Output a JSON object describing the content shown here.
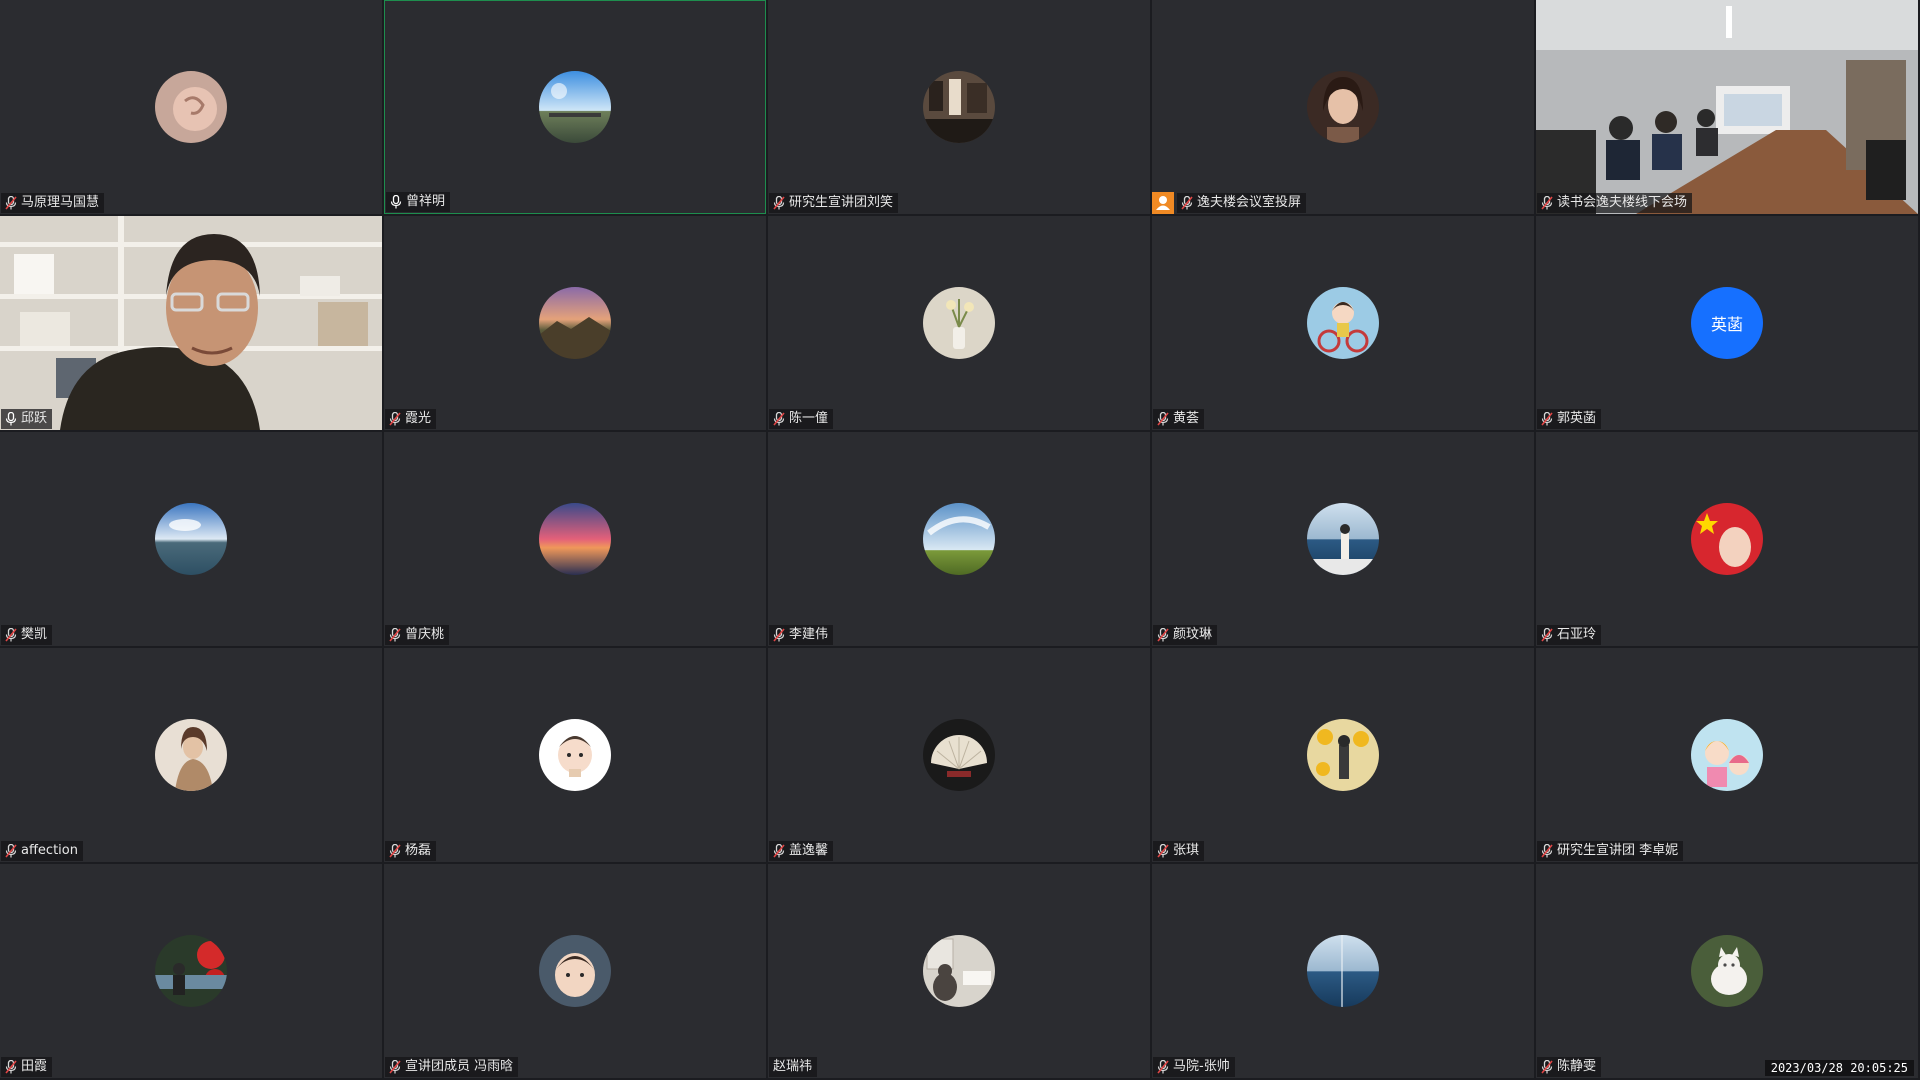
{
  "meeting": {
    "timestamp": "2023/03/28 20:05:25"
  },
  "participants": [
    {
      "name": "马原理马国慧",
      "avatar": "portrait-ear-avatar",
      "mic": "muted"
    },
    {
      "name": "曾祥明",
      "avatar": "beach-sky-avatar",
      "mic": "active",
      "speaking": true
    },
    {
      "name": "研究生宣讲团刘笑",
      "avatar": "cafe-scene-avatar",
      "mic": "muted"
    },
    {
      "name": "逸夫楼会议室投屏",
      "avatar": "woman-portrait-avatar",
      "mic": "muted",
      "person_badge": true
    },
    {
      "name": "读书会逸夫楼线下会场",
      "avatar": "conference-room-video",
      "mic": "muted",
      "video": true
    },
    {
      "name": "邱跃",
      "avatar": "man-bookshelf-video",
      "mic": "active",
      "video": true
    },
    {
      "name": "霞光",
      "avatar": "mountain-sunset-avatar",
      "mic": "muted"
    },
    {
      "name": "陈一僮",
      "avatar": "flower-vase-avatar",
      "mic": "muted"
    },
    {
      "name": "黄荟",
      "avatar": "cartoon-bicycle-avatar",
      "mic": "muted"
    },
    {
      "name": "郭英菡",
      "avatar_text": "英菡",
      "mic": "muted"
    },
    {
      "name": "樊凯",
      "avatar": "lake-sky-avatar",
      "mic": "muted"
    },
    {
      "name": "曾庆桃",
      "avatar": "sunset-sea-avatar",
      "mic": "muted"
    },
    {
      "name": "李建伟",
      "avatar": "grassland-sky-avatar",
      "mic": "muted"
    },
    {
      "name": "颜玟琳",
      "avatar": "seaside-girl-avatar",
      "mic": "muted"
    },
    {
      "name": "石亚玲",
      "avatar": "flag-face-avatar",
      "mic": "muted"
    },
    {
      "name": "affection",
      "avatar": "girl-portrait-avatar",
      "mic": "muted"
    },
    {
      "name": "杨磊",
      "avatar": "baby-face-avatar",
      "mic": "muted"
    },
    {
      "name": "盖逸馨",
      "avatar": "fan-art-avatar",
      "mic": "muted"
    },
    {
      "name": "张琪",
      "avatar": "sunflower-girl-avatar",
      "mic": "muted"
    },
    {
      "name": "研究生宣讲团 李卓妮",
      "avatar": "cartoon-girls-avatar",
      "mic": "muted"
    },
    {
      "name": "田霞",
      "avatar": "red-leaves-avatar",
      "mic": "muted"
    },
    {
      "name": "宣讲团成员 冯雨晗",
      "avatar": "toddler-avatar",
      "mic": "muted"
    },
    {
      "name": "赵瑞祎",
      "avatar": "cat-window-avatar",
      "mic": "none"
    },
    {
      "name": "马院-张帅",
      "avatar": "sea-horizon-avatar",
      "mic": "muted"
    },
    {
      "name": "陈静雯",
      "avatar": "white-cat-avatar",
      "mic": "muted"
    }
  ],
  "colors": {
    "tile_bg": "#2b2c30",
    "speaking_border": "#1e8e4e",
    "text_avatar_bg": "#1670ff",
    "person_badge": "#f08a24"
  }
}
